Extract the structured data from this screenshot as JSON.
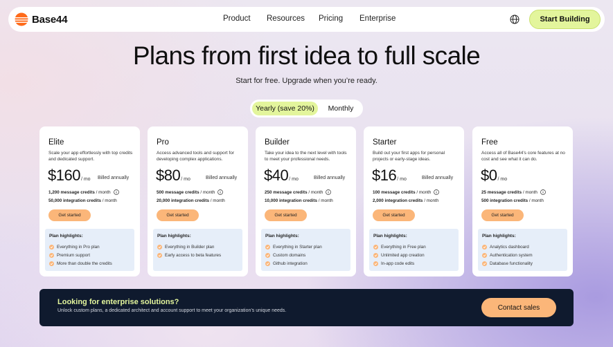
{
  "brand": {
    "name": "Base44"
  },
  "nav": {
    "links": [
      "Product",
      "Resources",
      "Pricing",
      "Enterprise"
    ],
    "cta": "Start Building"
  },
  "hero": {
    "title": "Plans from first idea to full scale",
    "subtitle": "Start for free. Upgrade when you’re ready."
  },
  "billing_toggle": {
    "yearly": "Yearly (save 20%)",
    "monthly": "Monthly",
    "selected": "yearly"
  },
  "plans": [
    {
      "name": "Elite",
      "description": "Scale your app effortlessly with top credits and dedicated support.",
      "price": "$160",
      "per": "/ mo",
      "billed": "Billed annually",
      "message_credits": "1,200 message credits",
      "message_per": " / month",
      "integration_credits": "50,000 integration credits",
      "integration_per": " / month",
      "cta": "Get started",
      "highlights_title": "Plan highlights:",
      "highlights": [
        "Everything in Pro plan",
        "Premium support",
        "More than double the credits"
      ]
    },
    {
      "name": "Pro",
      "description": "Access advanced tools and support for developing complex applications.",
      "price": "$80",
      "per": "/ mo",
      "billed": "Billed annually",
      "message_credits": "500 message credits",
      "message_per": " / month",
      "integration_credits": "20,000 integration credits",
      "integration_per": " / month",
      "cta": "Get started",
      "highlights_title": "Plan highlights:",
      "highlights": [
        "Everything in Builder plan",
        "Early access to beta features"
      ]
    },
    {
      "name": "Builder",
      "description": "Take your idea to the next level with tools to meet your professional needs.",
      "price": "$40",
      "per": "/ mo",
      "billed": "Billed annually",
      "message_credits": "250 message credits",
      "message_per": " / month",
      "integration_credits": "10,000 integration credits",
      "integration_per": " / month",
      "cta": "Get started",
      "highlights_title": "Plan highlights:",
      "highlights": [
        "Everything in Starter plan",
        "Custom domains",
        "Github integration"
      ]
    },
    {
      "name": "Starter",
      "description": "Build out your first apps for personal projects or early-stage ideas.",
      "price": "$16",
      "per": "/ mo",
      "billed": "Billed annually",
      "message_credits": "100 message credits",
      "message_per": " / month",
      "integration_credits": "2,000 integration credits",
      "integration_per": " / month",
      "cta": "Get started",
      "highlights_title": "Plan highlights:",
      "highlights": [
        "Everything in Free plan",
        "Unlimited app creation",
        "In-app code edits"
      ]
    },
    {
      "name": "Free",
      "description": "Access all of Base44’s core features at no cost and see what it can do.",
      "price": "$0",
      "per": "/ mo",
      "billed": "",
      "message_credits": "25 message credits",
      "message_per": " / month",
      "integration_credits": "500 integration credits",
      "integration_per": " / month",
      "cta": "Get started",
      "highlights_title": "Plan highlights:",
      "highlights": [
        "Analytics dashboard",
        "Authentication system",
        "Database functionality"
      ]
    }
  ],
  "enterprise": {
    "title": "Looking for enterprise solutions?",
    "text": "Unlock custom plans, a dedicated architect and account support to meet your organization’s unique needs.",
    "cta": "Contact sales"
  },
  "colors": {
    "accent_lime": "#e3f59c",
    "accent_orange": "#fbb679",
    "banner_bg": "#0f1a2e",
    "highlight_bg": "#e6eef9"
  },
  "icons": [
    "logo-icon",
    "globe-icon",
    "info-icon",
    "check-icon"
  ]
}
